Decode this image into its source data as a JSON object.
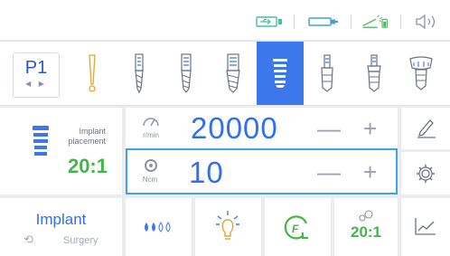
{
  "program": {
    "label": "P1",
    "arrows": "◀ ▶"
  },
  "tools": [
    {
      "name": "bur-probe-icon"
    },
    {
      "name": "drill-1-icon"
    },
    {
      "name": "drill-2-icon"
    },
    {
      "name": "drill-3-icon"
    },
    {
      "name": "implant-icon",
      "active": true
    },
    {
      "name": "tap-1-icon"
    },
    {
      "name": "tap-2-icon"
    },
    {
      "name": "abutment-icon"
    }
  ],
  "mode": {
    "label_line1": "Implant",
    "label_line2": "placement",
    "ratio": "20:1"
  },
  "speed": {
    "unit": "r/min",
    "value": "20000",
    "minus": "—",
    "plus": "+"
  },
  "torque": {
    "unit": "Ncm",
    "value": "10",
    "minus": "—",
    "plus": "+"
  },
  "bottom": {
    "title": "Implant",
    "subtitle": "Surgery",
    "ratio_button": "20:1"
  },
  "colors": {
    "accent": "#2f6ff0",
    "active_tool": "#3d77ec",
    "ratio_green": "#44b54a",
    "selected_border": "#3fa3e8"
  }
}
